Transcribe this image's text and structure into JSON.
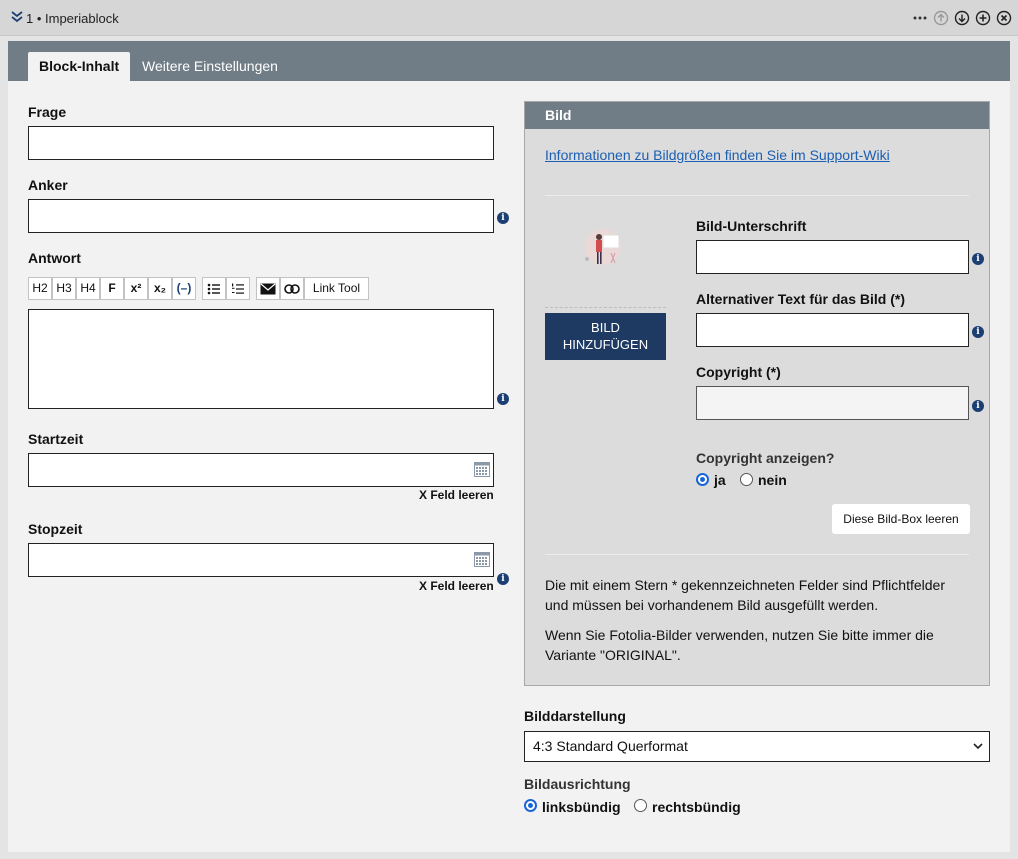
{
  "header": {
    "title": "1 • Imperiablock"
  },
  "tabs": [
    {
      "label": "Block-Inhalt"
    },
    {
      "label": "Weitere Einstellungen"
    }
  ],
  "left": {
    "frage_label": "Frage",
    "frage_value": "",
    "anker_label": "Anker",
    "anker_value": "",
    "antwort_label": "Antwort",
    "antwort_value": "",
    "toolbar": [
      "H2",
      "H3",
      "H4",
      "F",
      "x²",
      "x₂",
      "(–)",
      "bulleted-list-icon",
      "numbered-list-icon",
      "envelope-icon",
      "link-icon",
      "Link Tool"
    ],
    "link_tool_label": "Link Tool",
    "startzeit_label": "Startzeit",
    "startzeit_value": "",
    "stopzeit_label": "Stopzeit",
    "stopzeit_value": "",
    "clear_label": "X Feld leeren"
  },
  "bild": {
    "header": "Bild",
    "wiki_link": "Informationen zu Bildgrößen finden Sie im Support-Wiki",
    "add_button_line1": "BILD",
    "add_button_line2": "HINZUFÜGEN",
    "unterschrift_label": "Bild-Unterschrift",
    "unterschrift_value": "",
    "alt_label": "Alternativer Text für das Bild (*)",
    "alt_value": "",
    "copyright_label": "Copyright (*)",
    "copyright_value": "",
    "show_copyright_label": "Copyright anzeigen?",
    "opt_ja": "ja",
    "opt_nein": "nein",
    "selected": "ja",
    "clear_box_button": "Diese Bild-Box leeren",
    "note1": "Die mit einem Stern * gekennzeichneten Felder sind Pflichtfelder und müssen bei vorhandenem Bild ausgefüllt werden.",
    "note2": "Wenn Sie Fotolia-Bilder verwenden, nutzen Sie bitte immer die Variante \"ORIGINAL\"."
  },
  "darstellung": {
    "label": "Bilddarstellung",
    "selected": "4:3 Standard Querformat"
  },
  "ausrichtung": {
    "label": "Bildausrichtung",
    "opt_links": "linksbündig",
    "opt_rechts": "rechtsbündig",
    "selected": "linksbündig"
  },
  "colors": {
    "tabbar": "#707c86",
    "button": "#1e3a63",
    "info": "#1b3f73",
    "link": "#1b5fb3",
    "radio": "#1a66d6"
  }
}
